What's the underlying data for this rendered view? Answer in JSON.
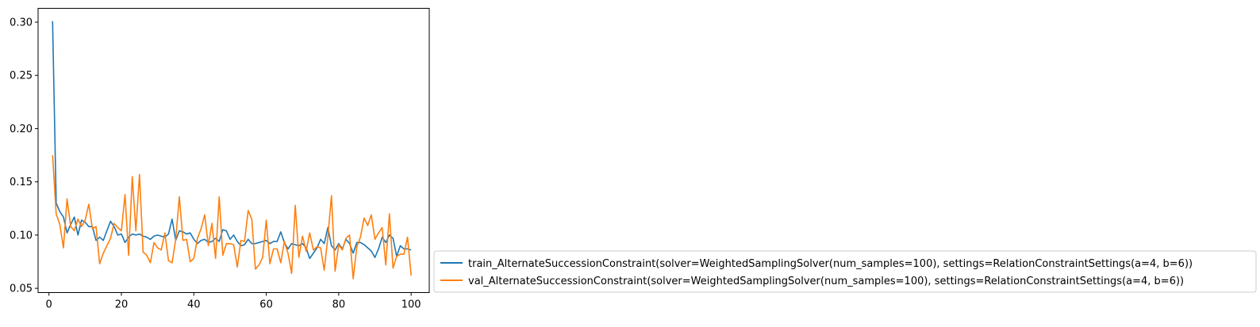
{
  "chart_data": {
    "type": "line",
    "title": "",
    "xlabel": "",
    "ylabel": "",
    "xlim": [
      -3,
      105
    ],
    "ylim": [
      0.046,
      0.313
    ],
    "xticks": [
      0,
      20,
      40,
      60,
      80,
      100
    ],
    "yticks": [
      0.05,
      0.1,
      0.15,
      0.2,
      0.25,
      0.3
    ],
    "grid": false,
    "legend_position": "outside-lower-right",
    "x": [
      1,
      2,
      3,
      4,
      5,
      6,
      7,
      8,
      9,
      10,
      11,
      12,
      13,
      14,
      15,
      16,
      17,
      18,
      19,
      20,
      21,
      22,
      23,
      24,
      25,
      26,
      27,
      28,
      29,
      30,
      31,
      32,
      33,
      34,
      35,
      36,
      37,
      38,
      39,
      40,
      41,
      42,
      43,
      44,
      45,
      46,
      47,
      48,
      49,
      50,
      51,
      52,
      53,
      54,
      55,
      56,
      57,
      58,
      59,
      60,
      61,
      62,
      63,
      64,
      65,
      66,
      67,
      68,
      69,
      70,
      71,
      72,
      73,
      74,
      75,
      76,
      77,
      78,
      79,
      80,
      81,
      82,
      83,
      84,
      85,
      86,
      87,
      88,
      89,
      90,
      91,
      92,
      93,
      94,
      95,
      96,
      97,
      98,
      99,
      100
    ],
    "series": [
      {
        "name": "train_AlternateSuccessionConstraint(solver=WeightedSamplingSolver(num_samples=100), settings=RelationConstraintSettings(a=4, b=6))",
        "color": "#1f77b4",
        "values": [
          0.301,
          0.13,
          0.122,
          0.117,
          0.102,
          0.11,
          0.117,
          0.1,
          0.114,
          0.112,
          0.108,
          0.108,
          0.095,
          0.098,
          0.095,
          0.104,
          0.113,
          0.108,
          0.1,
          0.101,
          0.093,
          0.098,
          0.101,
          0.1,
          0.101,
          0.099,
          0.098,
          0.096,
          0.099,
          0.1,
          0.099,
          0.098,
          0.101,
          0.115,
          0.095,
          0.104,
          0.103,
          0.101,
          0.102,
          0.096,
          0.092,
          0.095,
          0.096,
          0.093,
          0.094,
          0.097,
          0.094,
          0.105,
          0.104,
          0.096,
          0.1,
          0.094,
          0.09,
          0.091,
          0.096,
          0.092,
          0.092,
          0.093,
          0.094,
          0.095,
          0.092,
          0.094,
          0.094,
          0.103,
          0.093,
          0.087,
          0.092,
          0.091,
          0.09,
          0.092,
          0.088,
          0.078,
          0.083,
          0.088,
          0.096,
          0.092,
          0.107,
          0.09,
          0.086,
          0.092,
          0.087,
          0.096,
          0.092,
          0.083,
          0.093,
          0.093,
          0.091,
          0.088,
          0.085,
          0.079,
          0.087,
          0.098,
          0.093,
          0.1,
          0.097,
          0.08,
          0.09,
          0.087,
          0.087,
          0.086
        ]
      },
      {
        "name": "val_AlternateSuccessionConstraint(solver=WeightedSamplingSolver(num_samples=100), settings=RelationConstraintSettings(a=4, b=6))",
        "color": "#ff7f0e",
        "values": [
          0.175,
          0.12,
          0.11,
          0.088,
          0.134,
          0.108,
          0.104,
          0.115,
          0.108,
          0.114,
          0.129,
          0.106,
          0.108,
          0.073,
          0.083,
          0.09,
          0.097,
          0.111,
          0.107,
          0.104,
          0.138,
          0.081,
          0.155,
          0.104,
          0.157,
          0.084,
          0.081,
          0.074,
          0.093,
          0.088,
          0.086,
          0.102,
          0.076,
          0.074,
          0.096,
          0.136,
          0.095,
          0.096,
          0.075,
          0.078,
          0.097,
          0.106,
          0.119,
          0.09,
          0.111,
          0.078,
          0.136,
          0.081,
          0.092,
          0.092,
          0.091,
          0.07,
          0.095,
          0.094,
          0.123,
          0.115,
          0.068,
          0.072,
          0.079,
          0.114,
          0.073,
          0.087,
          0.087,
          0.074,
          0.094,
          0.083,
          0.064,
          0.128,
          0.079,
          0.099,
          0.085,
          0.102,
          0.086,
          0.089,
          0.088,
          0.067,
          0.098,
          0.137,
          0.066,
          0.091,
          0.086,
          0.097,
          0.1,
          0.059,
          0.089,
          0.098,
          0.116,
          0.109,
          0.119,
          0.096,
          0.102,
          0.107,
          0.072,
          0.12,
          0.069,
          0.08,
          0.082,
          0.082,
          0.098,
          0.062
        ]
      }
    ]
  }
}
